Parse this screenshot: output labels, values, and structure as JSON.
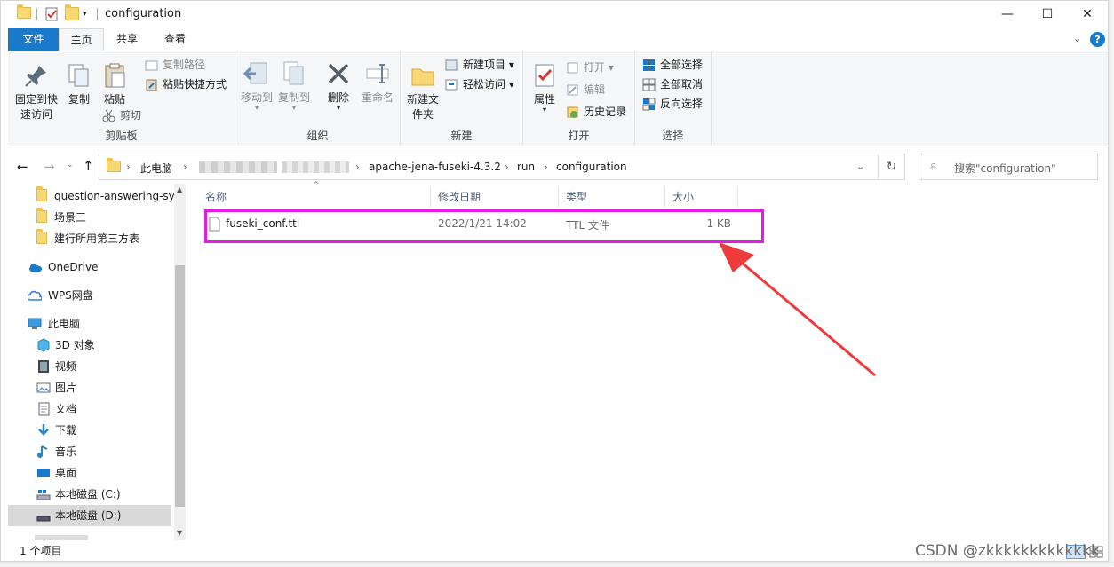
{
  "window": {
    "title": "configuration"
  },
  "tabs": {
    "file": "文件",
    "home": "主页",
    "share": "共享",
    "view": "查看"
  },
  "ribbon": {
    "clipboard": {
      "pin": "固定到快速访问",
      "copy": "复制",
      "paste": "粘贴",
      "copy_path": "复制路径",
      "paste_shortcut": "粘贴快捷方式",
      "cut": "剪切",
      "label": "剪贴板"
    },
    "organize": {
      "move_to": "移动到",
      "copy_to": "复制到",
      "delete": "删除",
      "rename": "重命名",
      "label": "组织"
    },
    "new": {
      "new_folder": "新建文件夹",
      "new_item": "新建项目",
      "easy_access": "轻松访问",
      "label": "新建"
    },
    "open": {
      "properties": "属性",
      "open": "打开",
      "edit": "编辑",
      "history": "历史记录",
      "label": "打开"
    },
    "select": {
      "select_all": "全部选择",
      "select_none": "全部取消",
      "invert": "反向选择",
      "label": "选择"
    }
  },
  "address": {
    "crumbs": [
      "此电脑",
      "apache-jena-fuseki-4.3.2",
      "run",
      "configuration"
    ],
    "search_placeholder": "搜索\"configuration\""
  },
  "nav": {
    "items": [
      "question-answering-sy",
      "场景三",
      "建行所用第三方表",
      "OneDrive",
      "WPS网盘",
      "此电脑",
      "3D 对象",
      "视频",
      "图片",
      "文档",
      "下载",
      "音乐",
      "桌面",
      "本地磁盘 (C:)",
      "本地磁盘 (D:)"
    ]
  },
  "columns": {
    "name": "名称",
    "modified": "修改日期",
    "type": "类型",
    "size": "大小"
  },
  "files": [
    {
      "name": "fuseki_conf.ttl",
      "modified": "2022/1/21 14:02",
      "type": "TTL 文件",
      "size": "1 KB"
    }
  ],
  "status": {
    "count": "1 个项目"
  },
  "watermark": "CSDN @zkkkkkkkkkkkkk",
  "colors": {
    "accent": "#1979ca",
    "highlight": "#e619e6",
    "arrow": "#ee3a3a"
  }
}
